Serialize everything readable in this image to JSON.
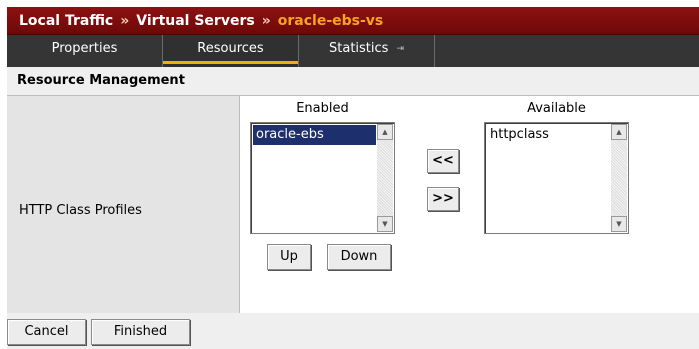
{
  "breadcrumb": {
    "items": [
      "Local Traffic",
      "Virtual Servers"
    ],
    "separator": "»",
    "current": "oracle-ebs-vs"
  },
  "tabs": [
    {
      "label": "Properties"
    },
    {
      "label": "Resources"
    },
    {
      "label": "Statistics"
    }
  ],
  "tab_extra_icon": "⇥",
  "section": {
    "title": "Resource Management"
  },
  "resource_row": {
    "label": "HTTP Class Profiles",
    "enabled": {
      "header": "Enabled",
      "options": [
        "oracle-ebs"
      ],
      "selected": "oracle-ebs"
    },
    "available": {
      "header": "Available",
      "options": [
        "httpclass"
      ]
    },
    "move_left_label": "<<",
    "move_right_label": ">>",
    "up_label": "Up",
    "down_label": "Down"
  },
  "footer": {
    "cancel_label": "Cancel",
    "finished_label": "Finished"
  },
  "colors": {
    "title_bg": "#7c0c0c",
    "current_crumb": "#f7a41d",
    "tab_bar": "#353535",
    "tab_underline": "#f0b000",
    "selection": "#1e2f6e"
  }
}
